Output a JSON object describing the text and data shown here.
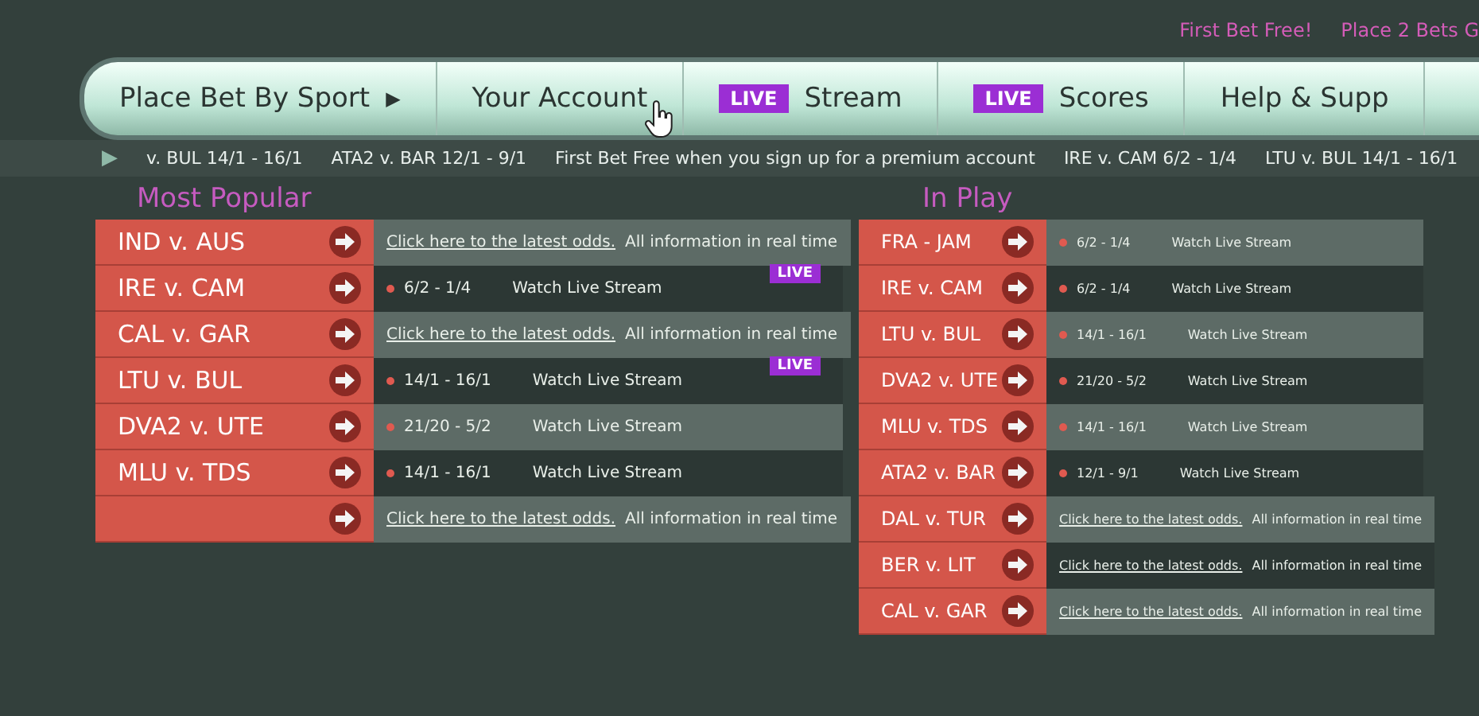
{
  "promos": [
    "First Bet Free!",
    "Place 2 Bets G"
  ],
  "nav": {
    "items": [
      {
        "kind": "menu",
        "label": "Place Bet By Sport",
        "caret": "▶"
      },
      {
        "kind": "plain",
        "label": "Your Account"
      },
      {
        "kind": "live",
        "badge": "LIVE",
        "label": "Stream"
      },
      {
        "kind": "live",
        "badge": "LIVE",
        "label": "Scores"
      },
      {
        "kind": "plain",
        "label": "Help & Supp"
      }
    ]
  },
  "ticker": {
    "marker": "▶",
    "items": [
      "v. BUL 14/1 - 16/1",
      "ATA2 v. BAR 12/1 - 9/1",
      "First Bet Free when you sign up for a premium account",
      "IRE v. CAM 6/2 - 1/4",
      "LTU v. BUL 14/1 - 16/1"
    ]
  },
  "most_popular": {
    "title": "Most Popular",
    "rows": [
      {
        "team": "IND v. AUS",
        "kind": "odds",
        "link": "Click here to the latest odds.",
        "note": "All information in real time",
        "live": false
      },
      {
        "team": "IRE v. CAM",
        "kind": "stream",
        "odds": "6/2 - 1/4",
        "stream": "Watch Live Stream",
        "live": true,
        "badge": "LIVE"
      },
      {
        "team": "CAL v. GAR",
        "kind": "odds",
        "link": "Click here to the latest odds.",
        "note": "All information in real time",
        "live": false
      },
      {
        "team": "LTU v. BUL",
        "kind": "stream",
        "odds": "14/1 - 16/1",
        "stream": "Watch Live Stream",
        "live": true,
        "badge": "LIVE"
      },
      {
        "team": "DVA2 v. UTE",
        "kind": "stream",
        "odds": "21/20 - 5/2",
        "stream": "Watch Live Stream",
        "live": false
      },
      {
        "team": "MLU v. TDS",
        "kind": "stream",
        "odds": "14/1 - 16/1",
        "stream": "Watch Live Stream",
        "live": false
      },
      {
        "kind": "odds",
        "link": "Click here to the latest odds.",
        "note": "All information in real time",
        "live": false
      }
    ]
  },
  "in_play": {
    "title": "In Play",
    "rows": [
      {
        "team": "FRA - JAM",
        "kind": "stream",
        "odds": "6/2 - 1/4",
        "stream": "Watch Live Stream",
        "live": false
      },
      {
        "team": "IRE v. CAM",
        "kind": "stream",
        "odds": "6/2 - 1/4",
        "stream": "Watch Live Stream",
        "live": false
      },
      {
        "team": "LTU v. BUL",
        "kind": "stream",
        "odds": "14/1 - 16/1",
        "stream": "Watch Live Stream",
        "live": false
      },
      {
        "team": "DVA2 v. UTE",
        "kind": "stream",
        "odds": "21/20 - 5/2",
        "stream": "Watch Live Stream",
        "live": false
      },
      {
        "team": "MLU v. TDS",
        "kind": "stream",
        "odds": "14/1 - 16/1",
        "stream": "Watch Live Stream",
        "live": false
      },
      {
        "team": "ATA2 v. BAR",
        "kind": "stream",
        "odds": "12/1 - 9/1",
        "stream": "Watch Live Stream",
        "live": false
      },
      {
        "team": "DAL v. TUR",
        "kind": "odds",
        "link": "Click here to the latest odds.",
        "note": "All information in real time",
        "live": false
      },
      {
        "team": "BER v. LIT",
        "kind": "odds",
        "link": "Click here to the latest odds.",
        "note": "All information in real time",
        "live": false
      },
      {
        "team": "CAL v. GAR",
        "kind": "odds",
        "link": "Click here to the latest odds.",
        "note": "All information in real time",
        "live": false
      }
    ]
  }
}
